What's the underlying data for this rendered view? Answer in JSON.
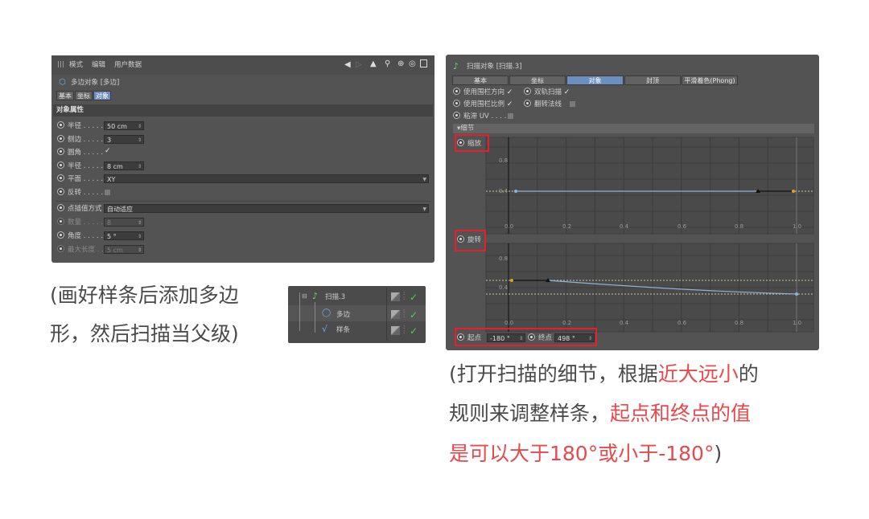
{
  "left_panel": {
    "menu": [
      "模式",
      "编辑",
      "用户数据"
    ],
    "title": "多边对象 [多边]",
    "tabs": [
      "基本",
      "坐标",
      "对象"
    ],
    "section": "对象属性",
    "fields": [
      {
        "label": "半径",
        "value": "50 cm"
      },
      {
        "label": "侧边",
        "value": "3"
      },
      {
        "label": "圆角",
        "value": "✓"
      },
      {
        "label": "半径",
        "value": "8 cm"
      },
      {
        "label": "平面",
        "value": "XY"
      },
      {
        "label": "反转",
        "value": ""
      }
    ],
    "interp_label": "点插值方式",
    "interp_value": "自动适应",
    "count_label": "数量",
    "count_value": "8",
    "angle_label": "角度",
    "angle_value": "5 °",
    "maxlen_label": "最大长度",
    "maxlen_value": "5 cm"
  },
  "caption_left": {
    "line1": "(画好样条后添加多边",
    "line2": "形，然后扫描当父级)"
  },
  "tree": {
    "items": [
      "扫描.3",
      "多边",
      "样条"
    ]
  },
  "right_panel": {
    "title": "扫描对象 [扫描.3]",
    "tabs": [
      "基本",
      "坐标",
      "对象",
      "封顶",
      "平滑着色(Phong)"
    ],
    "options": [
      {
        "label": "使用围栏方向",
        "check": "✓"
      },
      {
        "label": "双轨扫描",
        "check": "✓"
      },
      {
        "label": "使用围栏比例",
        "check": "✓"
      },
      {
        "label": "翻转法线",
        "check": ""
      },
      {
        "label": "粘滞 UV",
        "check": ""
      }
    ],
    "details_label": "细节",
    "scale_label": "缩放",
    "rotate_label": "旋转",
    "y_ticks": [
      "0.8",
      "0.4"
    ],
    "x_ticks": [
      "0.0",
      "0.2",
      "0.4",
      "0.6",
      "0.8",
      "1.0"
    ],
    "start_label": "起点",
    "start_value": "-180 °",
    "end_label": "终点",
    "end_value": "498 °"
  },
  "caption_right": {
    "l1a": "(打开扫描的细节，根据",
    "l1b": "近大远小",
    "l1c": "的",
    "l2a": "规则来调整样条，",
    "l2b": "起点和终点的值",
    "l3a": "是可以大于180°或小于-180°",
    "l3b": ")"
  },
  "colors": {
    "panel": "#535353",
    "accent_tab": "#6c8fbf",
    "highlight_red": "#e8494c",
    "box_red": "#e5202a"
  }
}
